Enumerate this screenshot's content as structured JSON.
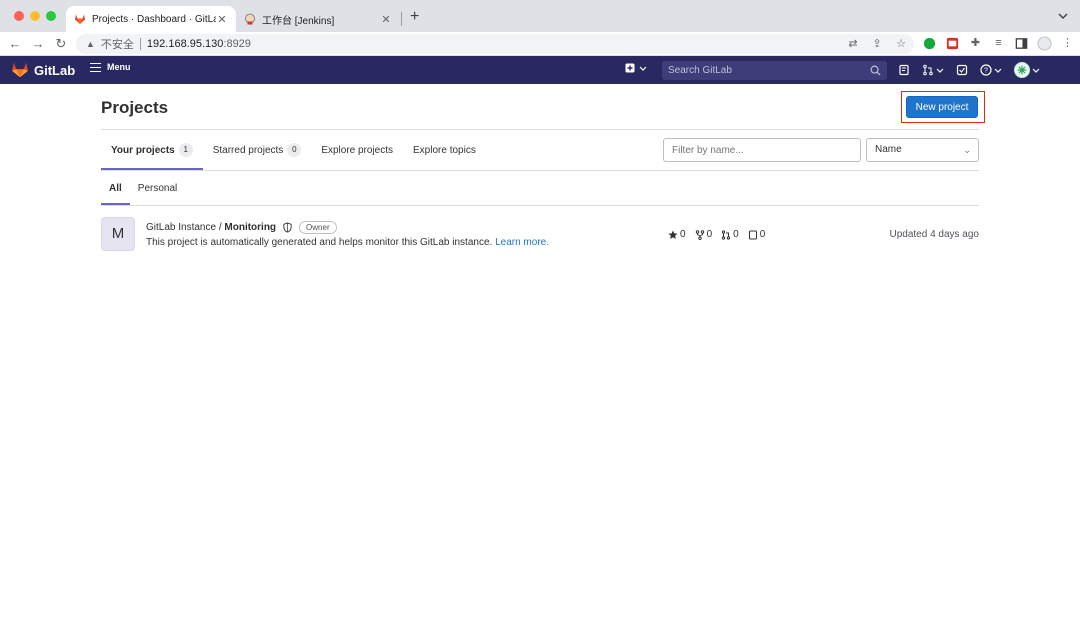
{
  "browser": {
    "tabs": [
      {
        "title": "Projects · Dashboard · GitLab",
        "active": true
      },
      {
        "title": "工作台 [Jenkins]",
        "active": false
      }
    ],
    "address": {
      "security": "不安全",
      "host": "192.168.95.130",
      "port": ":8929"
    }
  },
  "navbar": {
    "brand": "GitLab",
    "menu_label": "Menu",
    "search_placeholder": "Search GitLab"
  },
  "page": {
    "title": "Projects",
    "new_project_label": "New project",
    "tabs": [
      {
        "label": "Your projects",
        "count": "1"
      },
      {
        "label": "Starred projects",
        "count": "0"
      },
      {
        "label": "Explore projects"
      },
      {
        "label": "Explore topics"
      }
    ],
    "filter_placeholder": "Filter by name...",
    "sort_label": "Name",
    "subtabs": [
      {
        "label": "All"
      },
      {
        "label": "Personal"
      }
    ]
  },
  "projects": [
    {
      "avatar_letter": "M",
      "namespace": "GitLab Instance / ",
      "name": "Monitoring",
      "role": "Owner",
      "description": "This project is automatically generated and helps monitor this GitLab instance. ",
      "learn_more": "Learn more.",
      "stars": "0",
      "forks": "0",
      "merge_requests": "0",
      "issues": "0",
      "updated": "Updated 4 days ago"
    }
  ],
  "colors": {
    "navbar": "#292961",
    "primary_button": "#1f75cb",
    "highlight_box": "#dd2b0e",
    "tab_underline": "#6666c4"
  }
}
